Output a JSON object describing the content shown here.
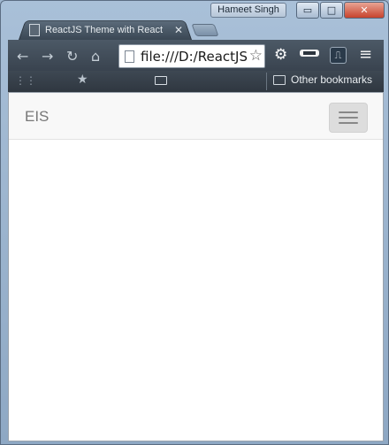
{
  "window": {
    "user_name": "Hameet Singh",
    "minimize_glyph": "▭",
    "maximize_glyph": "□",
    "close_glyph": "✕"
  },
  "tab": {
    "title": "ReactJS Theme with React",
    "close_glyph": "✕"
  },
  "toolbar": {
    "back_glyph": "←",
    "forward_glyph": "→",
    "reload_glyph": "↻",
    "home_glyph": "⌂",
    "address": "file:///D:/ReactJS",
    "star_glyph": "☆",
    "gear_glyph": "⚙",
    "menu_glyph": "≡"
  },
  "bookmarks": {
    "apps_glyph": "⋮⋮",
    "star_glyph": "★",
    "other_label": "Other bookmarks"
  },
  "page": {
    "brand": "EIS"
  },
  "colors": {
    "navbar_bg": "#f8f8f8",
    "brand_text": "#777777",
    "toggle_bg": "#dddddd",
    "toggle_bar": "#888888",
    "toolbar_bg": "#4c5966"
  }
}
